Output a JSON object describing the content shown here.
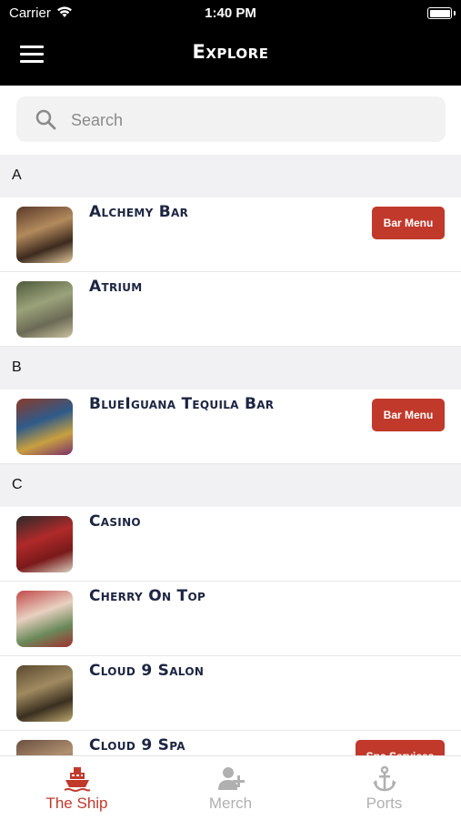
{
  "status_bar": {
    "carrier": "Carrier",
    "time": "1:40 PM",
    "battery_level": 1.0
  },
  "header": {
    "title": "Explore",
    "menu_icon": "hamburger-menu-icon"
  },
  "search": {
    "placeholder": "Search",
    "value": ""
  },
  "sections": [
    {
      "letter": "A",
      "items": [
        {
          "name": "Alchemy Bar",
          "button": "Bar Menu"
        },
        {
          "name": "Atrium",
          "button": null
        }
      ]
    },
    {
      "letter": "B",
      "items": [
        {
          "name": "BlueIguana Tequila Bar",
          "button": "Bar Menu"
        }
      ]
    },
    {
      "letter": "C",
      "items": [
        {
          "name": "Casino",
          "button": null
        },
        {
          "name": "Cherry On Top",
          "button": null
        },
        {
          "name": "Cloud 9 Salon",
          "button": null
        },
        {
          "name": "Cloud 9 Spa",
          "button": "Spa Services"
        }
      ]
    }
  ],
  "tabs": [
    {
      "label": "The Ship",
      "icon": "ship-icon",
      "active": true
    },
    {
      "label": "Merch",
      "icon": "add-person-icon",
      "active": false
    },
    {
      "label": "Ports",
      "icon": "anchor-icon",
      "active": false
    }
  ],
  "colors": {
    "accent": "#c0392b",
    "header_bg": "#000000",
    "title_text": "#1c2541",
    "section_bg": "#f1f1f3",
    "inactive_tab": "#b0b0b0"
  }
}
